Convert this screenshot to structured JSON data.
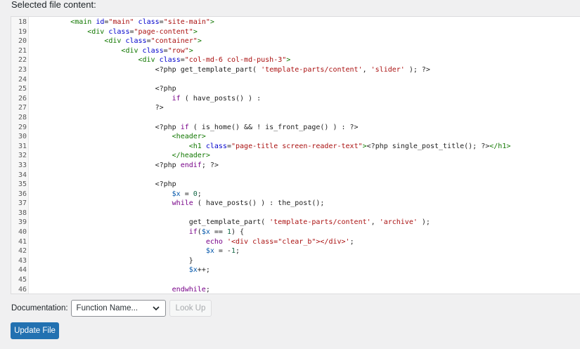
{
  "heading": "Selected file content:",
  "editor": {
    "lines": [
      {
        "n": "18",
        "tokens": [
          [
            "def",
            "        "
          ],
          [
            "tag",
            "<main"
          ],
          [
            "def",
            " "
          ],
          [
            "attr",
            "id"
          ],
          [
            "def",
            "="
          ],
          [
            "str",
            "\"main\""
          ],
          [
            "def",
            " "
          ],
          [
            "attr",
            "class"
          ],
          [
            "def",
            "="
          ],
          [
            "str",
            "\"site-main\""
          ],
          [
            "tag",
            ">"
          ]
        ]
      },
      {
        "n": "19",
        "tokens": [
          [
            "def",
            "            "
          ],
          [
            "tag",
            "<div"
          ],
          [
            "def",
            " "
          ],
          [
            "attr",
            "class"
          ],
          [
            "def",
            "="
          ],
          [
            "str",
            "\"page-content\""
          ],
          [
            "tag",
            ">"
          ]
        ]
      },
      {
        "n": "20",
        "tokens": [
          [
            "def",
            "                "
          ],
          [
            "tag",
            "<div"
          ],
          [
            "def",
            " "
          ],
          [
            "attr",
            "class"
          ],
          [
            "def",
            "="
          ],
          [
            "str",
            "\"container\""
          ],
          [
            "tag",
            ">"
          ]
        ]
      },
      {
        "n": "21",
        "tokens": [
          [
            "def",
            "                    "
          ],
          [
            "tag",
            "<div"
          ],
          [
            "def",
            " "
          ],
          [
            "attr",
            "class"
          ],
          [
            "def",
            "="
          ],
          [
            "str",
            "\"row\""
          ],
          [
            "tag",
            ">"
          ]
        ]
      },
      {
        "n": "22",
        "tokens": [
          [
            "def",
            "                        "
          ],
          [
            "tag",
            "<div"
          ],
          [
            "def",
            " "
          ],
          [
            "attr",
            "class"
          ],
          [
            "def",
            "="
          ],
          [
            "str",
            "\"col-md-6 col-md-push-3\""
          ],
          [
            "tag",
            ">"
          ]
        ]
      },
      {
        "n": "23",
        "tokens": [
          [
            "def",
            "                            <?php get_template_part( "
          ],
          [
            "str",
            "'template-parts/content'"
          ],
          [
            "def",
            ", "
          ],
          [
            "str",
            "'slider'"
          ],
          [
            "def",
            " ); ?>"
          ]
        ]
      },
      {
        "n": "24",
        "tokens": []
      },
      {
        "n": "25",
        "tokens": [
          [
            "def",
            "                            <?php"
          ]
        ]
      },
      {
        "n": "26",
        "tokens": [
          [
            "def",
            "                                "
          ],
          [
            "kw",
            "if"
          ],
          [
            "def",
            " ( have_posts() ) :"
          ]
        ]
      },
      {
        "n": "27",
        "tokens": [
          [
            "def",
            "                            ?>"
          ]
        ]
      },
      {
        "n": "28",
        "tokens": []
      },
      {
        "n": "29",
        "tokens": [
          [
            "def",
            "                            <?php "
          ],
          [
            "kw",
            "if"
          ],
          [
            "def",
            " ( is_home() && ! is_front_page() ) : ?>"
          ]
        ]
      },
      {
        "n": "30",
        "tokens": [
          [
            "def",
            "                                "
          ],
          [
            "tag",
            "<header>"
          ]
        ]
      },
      {
        "n": "31",
        "tokens": [
          [
            "def",
            "                                    "
          ],
          [
            "tag",
            "<h1"
          ],
          [
            "def",
            " "
          ],
          [
            "attr",
            "class"
          ],
          [
            "def",
            "="
          ],
          [
            "str",
            "\"page-title screen-reader-text\""
          ],
          [
            "tag",
            ">"
          ],
          [
            "def",
            "<?php single_post_title(); ?>"
          ],
          [
            "tag",
            "</h1>"
          ]
        ]
      },
      {
        "n": "32",
        "tokens": [
          [
            "def",
            "                                "
          ],
          [
            "tag",
            "</header>"
          ]
        ]
      },
      {
        "n": "33",
        "tokens": [
          [
            "def",
            "                            <?php "
          ],
          [
            "kw",
            "endif"
          ],
          [
            "def",
            "; ?>"
          ]
        ]
      },
      {
        "n": "34",
        "tokens": []
      },
      {
        "n": "35",
        "tokens": [
          [
            "def",
            "                            <?php"
          ]
        ]
      },
      {
        "n": "36",
        "tokens": [
          [
            "def",
            "                                "
          ],
          [
            "var",
            "$x"
          ],
          [
            "def",
            " = "
          ],
          [
            "num",
            "0"
          ],
          [
            "def",
            ";"
          ]
        ]
      },
      {
        "n": "37",
        "tokens": [
          [
            "def",
            "                                "
          ],
          [
            "kw",
            "while"
          ],
          [
            "def",
            " ( have_posts() ) : the_post();"
          ]
        ]
      },
      {
        "n": "38",
        "tokens": []
      },
      {
        "n": "39",
        "tokens": [
          [
            "def",
            "                                    get_template_part( "
          ],
          [
            "str",
            "'template-parts/content'"
          ],
          [
            "def",
            ", "
          ],
          [
            "str",
            "'archive'"
          ],
          [
            "def",
            " );"
          ]
        ]
      },
      {
        "n": "40",
        "tokens": [
          [
            "def",
            "                                    "
          ],
          [
            "kw",
            "if"
          ],
          [
            "def",
            "("
          ],
          [
            "var",
            "$x"
          ],
          [
            "def",
            " == "
          ],
          [
            "num",
            "1"
          ],
          [
            "def",
            ") {"
          ]
        ]
      },
      {
        "n": "41",
        "tokens": [
          [
            "def",
            "                                        "
          ],
          [
            "kw",
            "echo"
          ],
          [
            "def",
            " "
          ],
          [
            "str",
            "'<div class=\"clear_b\"></div>'"
          ],
          [
            "def",
            ";"
          ]
        ]
      },
      {
        "n": "42",
        "tokens": [
          [
            "def",
            "                                        "
          ],
          [
            "var",
            "$x"
          ],
          [
            "def",
            " = -"
          ],
          [
            "num",
            "1"
          ],
          [
            "def",
            ";"
          ]
        ]
      },
      {
        "n": "43",
        "tokens": [
          [
            "def",
            "                                    }"
          ]
        ]
      },
      {
        "n": "44",
        "tokens": [
          [
            "def",
            "                                    "
          ],
          [
            "var",
            "$x"
          ],
          [
            "def",
            "++;"
          ]
        ]
      },
      {
        "n": "45",
        "tokens": []
      },
      {
        "n": "46",
        "tokens": [
          [
            "def",
            "                                "
          ],
          [
            "kw",
            "endwhile"
          ],
          [
            "def",
            ";"
          ]
        ]
      }
    ]
  },
  "documentation": {
    "label": "Documentation:",
    "select_value": "Function Name...",
    "lookup_label": "Look Up"
  },
  "update_label": "Update File",
  "colors": {
    "primary": "#2271b1",
    "background": "#f0f0f1"
  }
}
